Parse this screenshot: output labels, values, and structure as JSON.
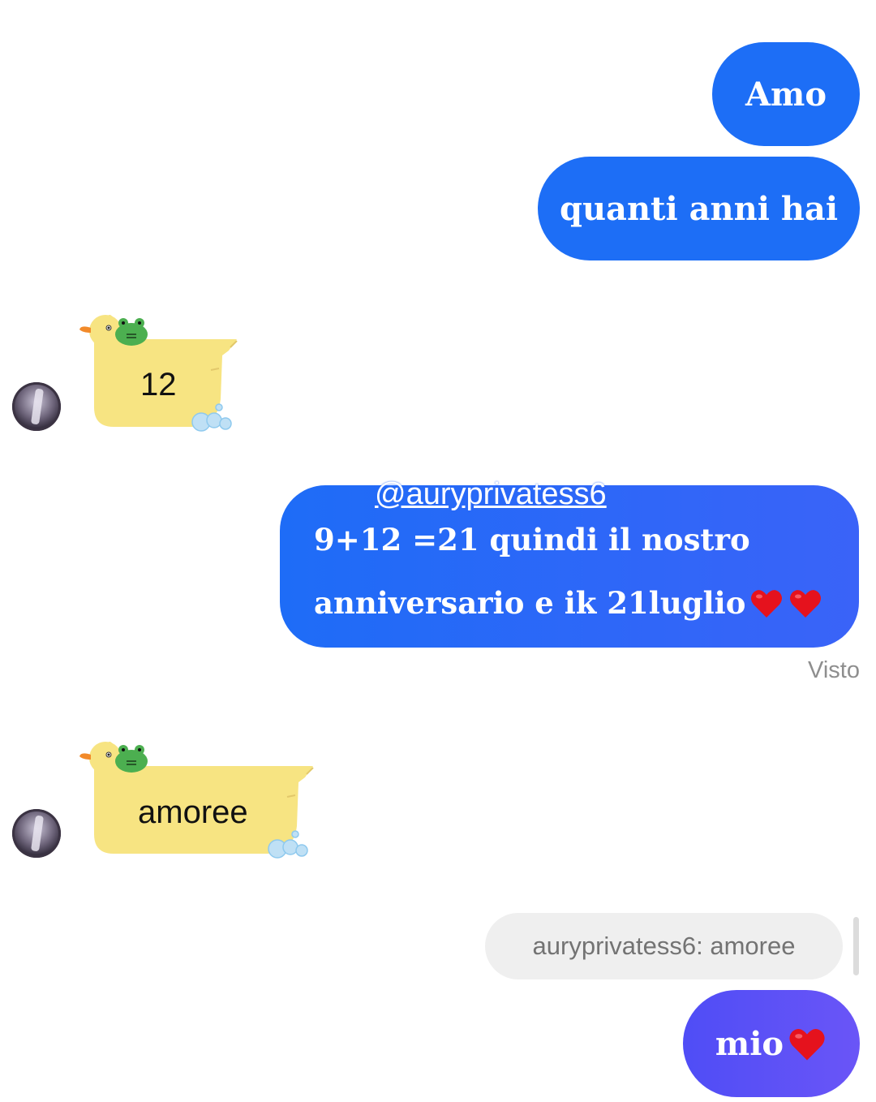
{
  "messages": {
    "amo": "Amo",
    "quanti": "quanti anni hai",
    "duck1_text": "12",
    "mention": "@auryprivatess6",
    "long_line1": "9+12 =21 quindi il nostro",
    "long_line2": "anniversario e ik 21luglio",
    "seen": "Visto",
    "duck2_text": "amoree",
    "reply_quote": "auryprivatess6: amoree",
    "mio": "mio"
  },
  "colors": {
    "outgoing_blue": "#1d6ef6",
    "outgoing_purple": "#5b50f6",
    "duck_yellow": "#f7e482",
    "heart_red": "#e5121d"
  },
  "icons": {
    "heart": "heart-emoji-icon",
    "duck": "duck-bubble-icon",
    "frog": "frog-icon",
    "bubbles": "soap-bubbles-icon"
  }
}
